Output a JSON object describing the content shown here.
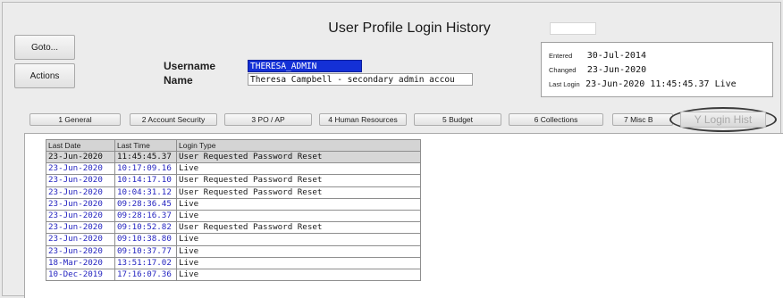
{
  "window": {
    "title": "User Profile Login History"
  },
  "side_buttons": {
    "goto": "Goto...",
    "actions": "Actions"
  },
  "user": {
    "username_label": "Username",
    "username_value": "THERESA_ADMIN",
    "name_label": "Name",
    "name_value": "Theresa Campbell - secondary admin accou"
  },
  "info": {
    "entered_label": "Entered",
    "entered_value": "30-Jul-2014",
    "changed_label": "Changed",
    "changed_value": "23-Jun-2020",
    "last_login_label": "Last Login",
    "last_login_value": "23-Jun-2020 11:45:45.37 Live"
  },
  "tabs": [
    {
      "label": "1 General"
    },
    {
      "label": "2 Account Security"
    },
    {
      "label": "3 PO / AP"
    },
    {
      "label": "4 Human Resources"
    },
    {
      "label": "5 Budget"
    },
    {
      "label": "6 Collections"
    },
    {
      "label": "7 Misc B"
    },
    {
      "label": "Y Login Hist",
      "active": true
    }
  ],
  "table": {
    "headers": [
      "Last Date",
      "Last Time",
      "Login Type"
    ],
    "rows": [
      {
        "date": "23-Jun-2020",
        "time": "11:45:45.37",
        "type": "User Requested Password Reset",
        "selected": true
      },
      {
        "date": "23-Jun-2020",
        "time": "10:17:09.16",
        "type": "Live"
      },
      {
        "date": "23-Jun-2020",
        "time": "10:14:17.10",
        "type": "User Requested Password Reset"
      },
      {
        "date": "23-Jun-2020",
        "time": "10:04:31.12",
        "type": "User Requested Password Reset"
      },
      {
        "date": "23-Jun-2020",
        "time": "09:28:36.45",
        "type": "Live"
      },
      {
        "date": "23-Jun-2020",
        "time": "09:28:16.37",
        "type": "Live"
      },
      {
        "date": "23-Jun-2020",
        "time": "09:10:52.82",
        "type": "User Requested Password Reset"
      },
      {
        "date": "23-Jun-2020",
        "time": "09:10:38.80",
        "type": "Live"
      },
      {
        "date": "23-Jun-2020",
        "time": "09:10:37.77",
        "type": "Live"
      },
      {
        "date": "18-Mar-2020",
        "time": "13:51:17.02",
        "type": "Live"
      },
      {
        "date": "10-Dec-2019",
        "time": "17:16:07.36",
        "type": "Live"
      }
    ]
  },
  "colors": {
    "selection_blue": "#1430d6",
    "link_blue": "#2424c0",
    "window_gray": "#ececec"
  }
}
